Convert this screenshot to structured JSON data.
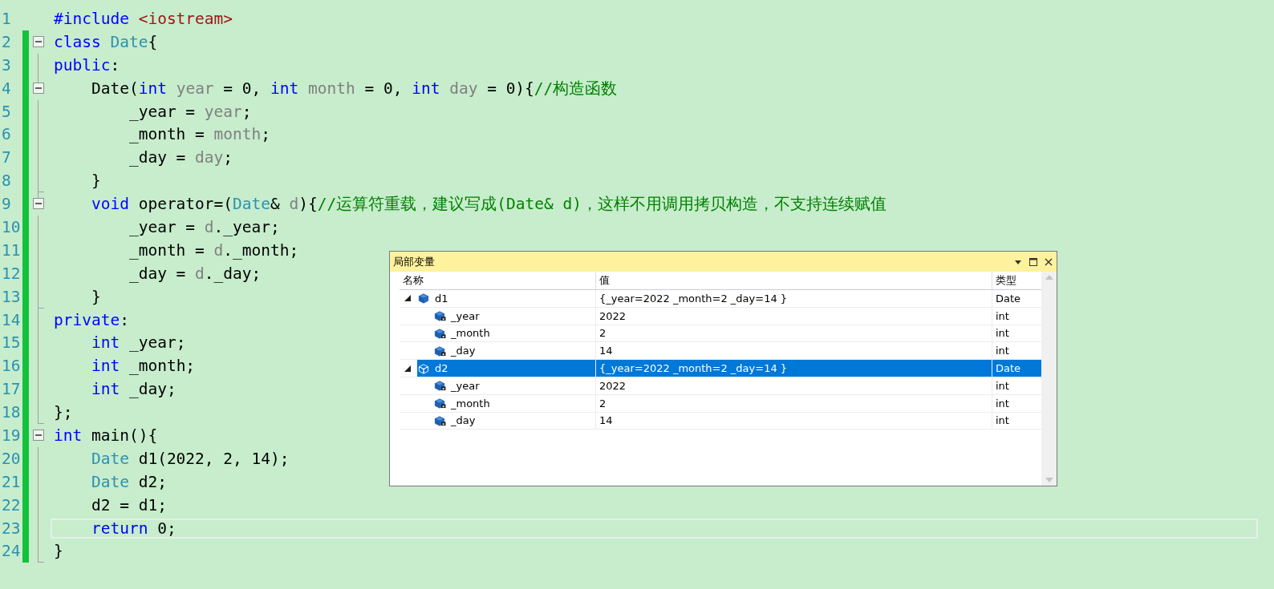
{
  "editor": {
    "lines": [
      {
        "number": "1",
        "changed": false,
        "kind": "plain",
        "current": false,
        "tokens": [
          {
            "kind": "keyword",
            "text": "#include"
          },
          {
            "kind": "string",
            "text": " <iostream>"
          }
        ]
      },
      {
        "number": "2",
        "changed": true,
        "kind": "fold_start",
        "current": false,
        "tokens": [
          {
            "kind": "keyword",
            "text": "class"
          },
          {
            "kind": "type",
            "text": " Date"
          },
          {
            "kind": "plain",
            "text": "{"
          }
        ]
      },
      {
        "number": "3",
        "changed": true,
        "kind": "fold_body",
        "current": false,
        "tokens": [
          {
            "kind": "keyword",
            "text": "public"
          },
          {
            "kind": "plain",
            "text": ":"
          }
        ]
      },
      {
        "number": "4",
        "changed": true,
        "kind": "fold_start",
        "current": false,
        "tokens": [
          {
            "kind": "plain",
            "text": "    Date("
          },
          {
            "kind": "keyword",
            "text": "int"
          },
          {
            "kind": "param",
            "text": " year"
          },
          {
            "kind": "plain",
            "text": " = 0, "
          },
          {
            "kind": "keyword",
            "text": "int"
          },
          {
            "kind": "param",
            "text": " month"
          },
          {
            "kind": "plain",
            "text": " = 0, "
          },
          {
            "kind": "keyword",
            "text": "int"
          },
          {
            "kind": "param",
            "text": " day"
          },
          {
            "kind": "plain",
            "text": " = 0){"
          },
          {
            "kind": "comment",
            "text": "//构造函数"
          }
        ]
      },
      {
        "number": "5",
        "changed": true,
        "kind": "fold_body",
        "current": false,
        "tokens": [
          {
            "kind": "plain",
            "text": "        _year = "
          },
          {
            "kind": "param",
            "text": "year"
          },
          {
            "kind": "plain",
            "text": ";"
          }
        ]
      },
      {
        "number": "6",
        "changed": true,
        "kind": "fold_body",
        "current": false,
        "tokens": [
          {
            "kind": "plain",
            "text": "        _month = "
          },
          {
            "kind": "param",
            "text": "month"
          },
          {
            "kind": "plain",
            "text": ";"
          }
        ]
      },
      {
        "number": "7",
        "changed": true,
        "kind": "fold_body",
        "current": false,
        "tokens": [
          {
            "kind": "plain",
            "text": "        _day = "
          },
          {
            "kind": "param",
            "text": "day"
          },
          {
            "kind": "plain",
            "text": ";"
          }
        ]
      },
      {
        "number": "8",
        "changed": true,
        "kind": "fold_end",
        "current": false,
        "tokens": [
          {
            "kind": "plain",
            "text": "    }"
          }
        ]
      },
      {
        "number": "9",
        "changed": true,
        "kind": "fold_start",
        "current": false,
        "tokens": [
          {
            "kind": "keyword",
            "text": "    void"
          },
          {
            "kind": "plain",
            "text": " operator=("
          },
          {
            "kind": "type",
            "text": "Date"
          },
          {
            "kind": "plain",
            "text": "& "
          },
          {
            "kind": "param",
            "text": "d"
          },
          {
            "kind": "plain",
            "text": "){"
          },
          {
            "kind": "comment",
            "text": "//运算符重载，建议写成(Date& d)，这样不用调用拷贝构造，不支持连续赋值"
          }
        ]
      },
      {
        "number": "10",
        "changed": true,
        "kind": "fold_body",
        "current": false,
        "tokens": [
          {
            "kind": "plain",
            "text": "        _year = "
          },
          {
            "kind": "param",
            "text": "d"
          },
          {
            "kind": "plain",
            "text": "._year;"
          }
        ]
      },
      {
        "number": "11",
        "changed": true,
        "kind": "fold_body",
        "current": false,
        "tokens": [
          {
            "kind": "plain",
            "text": "        _month = "
          },
          {
            "kind": "param",
            "text": "d"
          },
          {
            "kind": "plain",
            "text": "._month;"
          }
        ]
      },
      {
        "number": "12",
        "changed": true,
        "kind": "fold_body",
        "current": false,
        "tokens": [
          {
            "kind": "plain",
            "text": "        _day = "
          },
          {
            "kind": "param",
            "text": "d"
          },
          {
            "kind": "plain",
            "text": "._day;"
          }
        ]
      },
      {
        "number": "13",
        "changed": true,
        "kind": "fold_end",
        "current": false,
        "tokens": [
          {
            "kind": "plain",
            "text": "    }"
          }
        ]
      },
      {
        "number": "14",
        "changed": true,
        "kind": "fold_body",
        "current": false,
        "tokens": [
          {
            "kind": "keyword",
            "text": "private"
          },
          {
            "kind": "plain",
            "text": ":"
          }
        ]
      },
      {
        "number": "15",
        "changed": true,
        "kind": "fold_body",
        "current": false,
        "tokens": [
          {
            "kind": "keyword",
            "text": "    int"
          },
          {
            "kind": "plain",
            "text": " _year;"
          }
        ]
      },
      {
        "number": "16",
        "changed": true,
        "kind": "fold_body",
        "current": false,
        "tokens": [
          {
            "kind": "keyword",
            "text": "    int"
          },
          {
            "kind": "plain",
            "text": " _month;"
          }
        ]
      },
      {
        "number": "17",
        "changed": true,
        "kind": "fold_body",
        "current": false,
        "tokens": [
          {
            "kind": "keyword",
            "text": "    int"
          },
          {
            "kind": "plain",
            "text": " _day;"
          }
        ]
      },
      {
        "number": "18",
        "changed": true,
        "kind": "fold_end",
        "current": false,
        "tokens": [
          {
            "kind": "plain",
            "text": "};"
          }
        ]
      },
      {
        "number": "19",
        "changed": true,
        "kind": "fold_start",
        "current": false,
        "tokens": [
          {
            "kind": "keyword",
            "text": "int"
          },
          {
            "kind": "plain",
            "text": " main(){"
          }
        ]
      },
      {
        "number": "20",
        "changed": true,
        "kind": "fold_body",
        "current": false,
        "tokens": [
          {
            "kind": "type",
            "text": "    Date"
          },
          {
            "kind": "plain",
            "text": " d1(2022, 2, 14);"
          }
        ]
      },
      {
        "number": "21",
        "changed": true,
        "kind": "fold_body",
        "current": false,
        "tokens": [
          {
            "kind": "type",
            "text": "    Date"
          },
          {
            "kind": "plain",
            "text": " d2;"
          }
        ]
      },
      {
        "number": "22",
        "changed": true,
        "kind": "fold_body",
        "current": false,
        "tokens": [
          {
            "kind": "plain",
            "text": "    d2 = d1;"
          }
        ]
      },
      {
        "number": "23",
        "changed": true,
        "kind": "fold_body",
        "current": true,
        "tokens": [
          {
            "kind": "keyword",
            "text": "    return"
          },
          {
            "kind": "plain",
            "text": " 0;"
          }
        ]
      },
      {
        "number": "24",
        "changed": true,
        "kind": "fold_end",
        "current": false,
        "tokens": [
          {
            "kind": "plain",
            "text": "}"
          }
        ]
      }
    ]
  },
  "locals_window": {
    "title": "局部变量",
    "columns": [
      "名称",
      "值",
      "类型"
    ],
    "items": [
      {
        "name": "d1",
        "value": "{_year=2022 _month=2 _day=14 }",
        "type": "Date",
        "expanded": true,
        "selected": false,
        "children": [
          {
            "name": "_year",
            "value": "2022",
            "type": "int",
            "selected": false
          },
          {
            "name": "_month",
            "value": "2",
            "type": "int",
            "selected": false
          },
          {
            "name": "_day",
            "value": "14",
            "type": "int",
            "selected": false
          }
        ]
      },
      {
        "name": "d2",
        "value": "{_year=2022 _month=2 _day=14 }",
        "type": "Date",
        "expanded": true,
        "selected": true,
        "children": [
          {
            "name": "_year",
            "value": "2022",
            "type": "int",
            "selected": false
          },
          {
            "name": "_month",
            "value": "2",
            "type": "int",
            "selected": false
          },
          {
            "name": "_day",
            "value": "14",
            "type": "int",
            "selected": false
          }
        ]
      }
    ]
  }
}
